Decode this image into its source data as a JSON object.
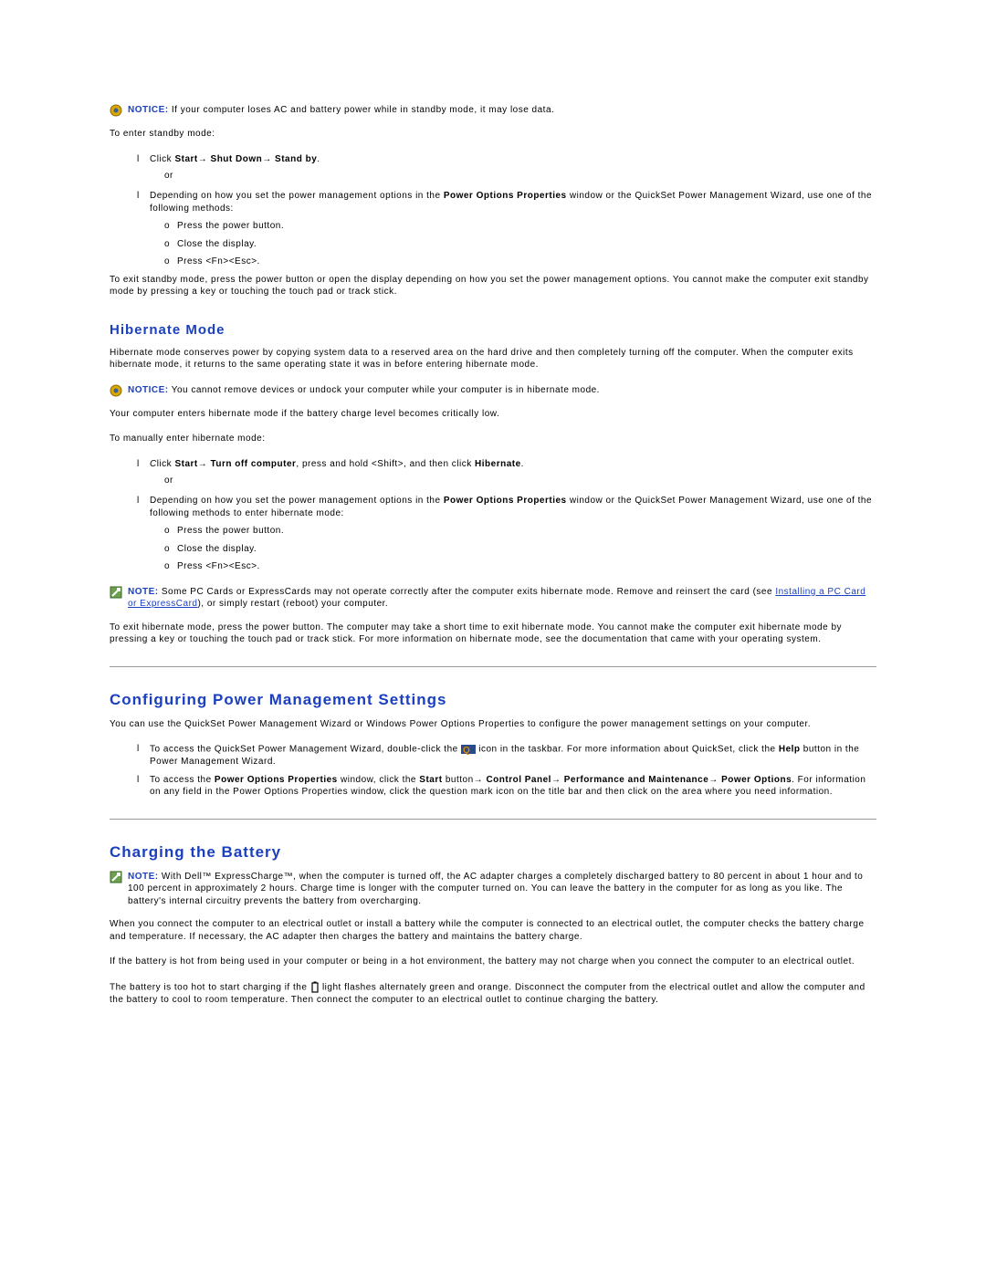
{
  "notice1": {
    "label": "NOTICE:",
    "text": "If your computer loses AC and battery power while in standby mode, it may lose data."
  },
  "standby": {
    "intro": "To enter standby mode:",
    "item1_pre": "Click ",
    "item1_b1": "Start",
    "item1_arrow1": "→ ",
    "item1_b2": "Shut Down",
    "item1_arrow2": "→ ",
    "item1_b3": "Stand by",
    "item1_post": ".",
    "or": "or",
    "item2_pre": "Depending on how you set the power management options in the ",
    "item2_b1": "Power Options Properties",
    "item2_mid": " window or the QuickSet Power Management Wizard, use one of the following methods:",
    "sub1": "Press the power button.",
    "sub2": "Close the display.",
    "sub3": "Press <Fn><Esc>.",
    "exit": "To exit standby mode, press the power button or open the display depending on how you set the power management options. You cannot make the computer exit standby mode by pressing a key or touching the touch pad or track stick."
  },
  "hibernate": {
    "title": "Hibernate Mode",
    "p1": "Hibernate mode conserves power by copying system data to a reserved area on the hard drive and then completely turning off the computer. When the computer exits hibernate mode, it returns to the same operating state it was in before entering hibernate mode.",
    "notice_label": "NOTICE:",
    "notice_text": "You cannot remove devices or undock your computer while your computer is in hibernate mode.",
    "p2": "Your computer enters hibernate mode if the battery charge level becomes critically low.",
    "p3": "To manually enter hibernate mode:",
    "item1_i": "C",
    "item1_pre": "lick ",
    "item1_b1": "Start",
    "item1_arrow1": "→ ",
    "item1_b2": "Turn off computer",
    "item1_mid": ", press and hold <Shift>, and then click ",
    "item1_b3": "Hibernate",
    "item1_post": ".",
    "or": "or",
    "item2_pre": "Depending on how you set the power management options in the ",
    "item2_b1": "Power Options Properties",
    "item2_mid": " window or the QuickSet Power Management Wizard, use one of the following methods to enter hibernate mode:",
    "sub1": "Press the power button.",
    "sub2": "Close the display.",
    "sub3": "Press <Fn><Esc>.",
    "note_label": "NOTE:",
    "note_text_pre": "Some PC Cards or ExpressCards may not operate correctly after the computer exits hibernate mode. Remove and reinsert the card (see ",
    "note_link": "Installing a PC Card or ExpressCard",
    "note_text_post": "), or simply restart (reboot) your computer.",
    "exit": "To exit hibernate mode, press the power button. The computer may take a short time to exit hibernate mode. You cannot make the computer exit hibernate mode by pressing a key or touching the touch pad or track stick. For more information on hibernate mode, see the documentation that came with your operating system."
  },
  "config": {
    "title": "Configuring Power Management Settings",
    "p1": "You can use the QuickSet Power Management Wizard or Windows Power Options Properties to configure the power management settings on your computer.",
    "item1_pre": "To access the QuickSet Power Management Wizard, double-click the ",
    "item1_post": " icon in the taskbar. For more information about QuickSet, click the ",
    "item1_b1": "Help",
    "item1_post2": " button in the Power Management Wizard.",
    "item2_pre": "To access the ",
    "item2_b1": "Power Options Properties",
    "item2_mid1": " window, click the ",
    "item2_b2": "Start",
    "item2_mid2": " button→ ",
    "item2_b3": "Control Panel",
    "item2_arr1": "→ ",
    "item2_b4": "Performance and Maintenance",
    "item2_arr2": "→ ",
    "item2_b5": "Power Options",
    "item2_post": ". For information on any field in the Power Options Properties window, click the question mark icon on the title bar and then click on the area where you need information."
  },
  "charging": {
    "title": "Charging the Battery",
    "note_label": "NOTE:",
    "note_text": "With Dell™ ExpressCharge™, when the computer is turned off, the AC adapter charges a completely discharged battery to 80 percent in about 1 hour and to 100 percent in approximately 2 hours. Charge time is longer with the computer turned on. You can leave the battery in the computer for as long as you like. The battery's internal circuitry prevents the battery from overcharging.",
    "p1": "When you connect the computer to an electrical outlet or install a battery while the computer is connected to an electrical outlet, the computer checks the battery charge and temperature. If necessary, the AC adapter then charges the battery and maintains the battery charge.",
    "p2": "If the battery is hot from being used in your computer or being in a hot environment, the battery may not charge when you connect the computer to an electrical outlet.",
    "p3_pre": "The battery is too hot to start charging if the ",
    "p3_post": " light flashes alternately green and orange. Disconnect the computer from the electrical outlet and allow the computer and the battery to cool to room temperature. Then connect the computer to an electrical outlet to continue charging the battery."
  }
}
